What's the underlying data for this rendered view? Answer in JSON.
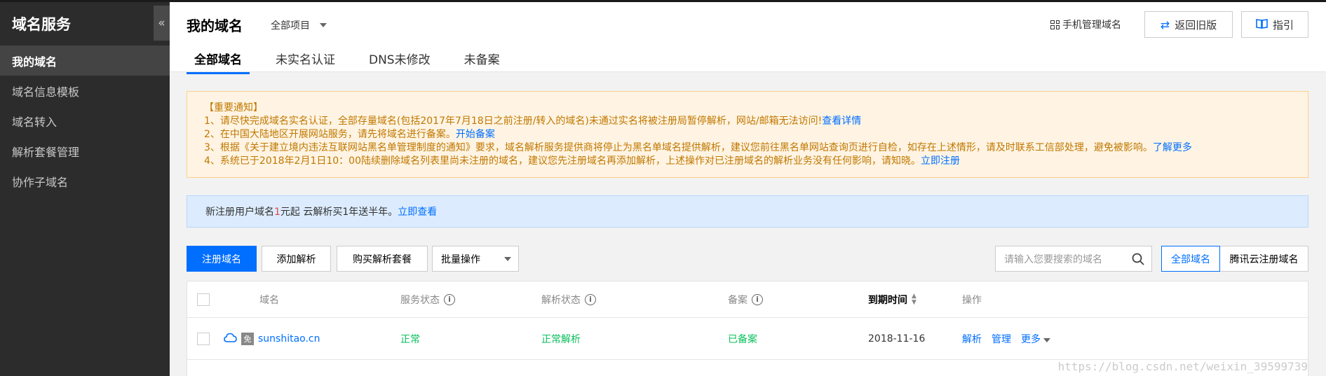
{
  "sidebar": {
    "title": "域名服务",
    "collapse_icon": "«",
    "items": [
      {
        "label": "我的域名",
        "active": true
      },
      {
        "label": "域名信息模板"
      },
      {
        "label": "域名转入"
      },
      {
        "label": "解析套餐管理"
      },
      {
        "label": "协作子域名"
      }
    ]
  },
  "header": {
    "title": "我的域名",
    "project": "全部项目",
    "mobile_link": "手机管理域名",
    "old_version_button": "返回旧版",
    "guide_button": "指引",
    "tabs": [
      {
        "label": "全部域名",
        "active": true
      },
      {
        "label": "未实名认证"
      },
      {
        "label": "DNS未修改"
      },
      {
        "label": "未备案"
      }
    ]
  },
  "notice_warning": {
    "title": "【重要通知】",
    "lines": [
      {
        "text": "1、请尽快完成域名实名认证，全部存量域名(包括2017年7月18日之前注册/转入的域名)未通过实名将被注册局暂停解析，网站/邮箱无法访问!",
        "link": "查看详情"
      },
      {
        "text": "2、在中国大陆地区开展网站服务，请先将域名进行备案。",
        "link": "开始备案"
      },
      {
        "text": "3、根据《关于建立境内违法互联网站黑名单管理制度的通知》要求，域名解析服务提供商将停止为黑名单域名提供解析，建议您前往黑名单网站查询页进行自检，如存在上述情形，请及时联系工信部处理，避免被影响。",
        "link": "了解更多"
      },
      {
        "text": "4、系统已于2018年2月1日10：00陆续删除域名列表里尚未注册的域名，建议您先注册域名再添加解析，上述操作对已注册域名的解析业务没有任何影响，请知晓。",
        "link": "立即注册"
      }
    ]
  },
  "notice_info": {
    "prefix": "新注册用户域名",
    "highlight": "1",
    "suffix": "元起 云解析买1年送半年。",
    "link": "立即查看"
  },
  "toolbar": {
    "register": "注册域名",
    "add_resolve": "添加解析",
    "buy_package": "购买解析套餐",
    "batch": "批量操作",
    "search_placeholder": "请输入您要搜索的域名",
    "filter_all": "全部域名",
    "filter_tencent": "腾讯云注册域名"
  },
  "table": {
    "headers": {
      "domain": "域名",
      "service_status": "服务状态",
      "resolve_status": "解析状态",
      "icp": "备案",
      "expire": "到期时间",
      "actions": "操作"
    },
    "rows": [
      {
        "free_badge": "免",
        "domain": "sunshitao.cn",
        "service_status": "正常",
        "resolve_status": "正常解析",
        "icp": "已备案",
        "expire": "2018-11-16",
        "action_resolve": "解析",
        "action_manage": "管理",
        "action_more": "更多"
      }
    ]
  },
  "watermark": "https://blog.csdn.net/weixin_39599739",
  "colors": {
    "accent": "#006eff",
    "success": "#0abf5b",
    "warning_text": "#c07700",
    "sidebar_bg": "#2c2c2c"
  }
}
